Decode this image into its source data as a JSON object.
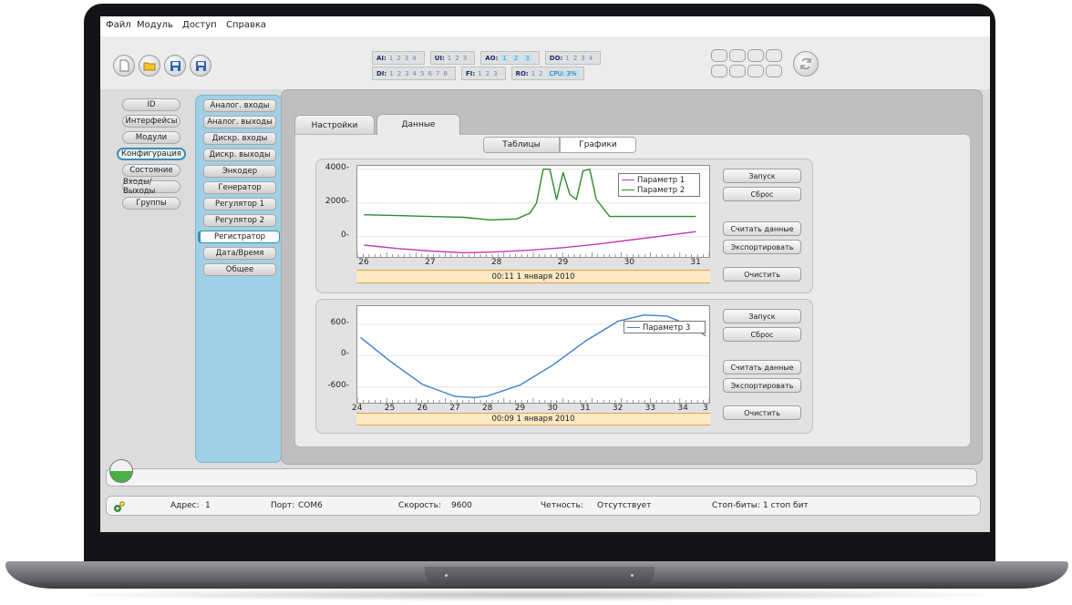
{
  "menu": [
    "Файл",
    "Модуль",
    "Доступ",
    "Справка"
  ],
  "toolbar": {
    "io_row1": [
      {
        "label": "AI:",
        "nums": [
          "1",
          "2",
          "3",
          "4"
        ]
      },
      {
        "label": "UI:",
        "nums": [
          "1",
          "2",
          "3"
        ]
      },
      {
        "label": "AO:",
        "nums": [
          "1",
          "2",
          "3"
        ],
        "highlight": true
      },
      {
        "label": "DO:",
        "nums": [
          "1",
          "2",
          "3",
          "4"
        ]
      }
    ],
    "io_row2": [
      {
        "label": "DI:",
        "nums": [
          "1",
          "2",
          "3",
          "4",
          "5",
          "6",
          "7",
          "8"
        ]
      },
      {
        "label": "FI:",
        "nums": [
          "1",
          "2",
          "3"
        ]
      },
      {
        "label": "RO:",
        "nums": [
          "1",
          "2"
        ]
      }
    ],
    "cpu": "CPU: 3%"
  },
  "nav_primary": [
    "ID",
    "Интерфейсы",
    "Модули",
    "Конфигурация",
    "Состояние",
    "Входы/Выходы",
    "Группы"
  ],
  "nav_primary_active": 3,
  "nav_secondary": [
    "Аналог. входы",
    "Аналог. выходы",
    "Дискр. входы",
    "Дискр. выходы",
    "Энкодер",
    "Генератор",
    "Регулятор 1",
    "Регулятор 2",
    "Регистратор",
    "Дата/Время",
    "Общее"
  ],
  "nav_secondary_active": 8,
  "tabs": [
    "Настройки",
    "Данные"
  ],
  "tabs_active": 1,
  "view_toggle": [
    "Таблицы",
    "Графики"
  ],
  "view_active": 1,
  "buttons": {
    "start": "Запуск",
    "reset": "Сброс",
    "read": "Считать данные",
    "export": "Экспортировать",
    "clear": "Очистить"
  },
  "chart1_caption": "00:11 1 января 2010",
  "chart2_caption": "00:09 1 января 2010",
  "status": {
    "address_label": "Адрес:",
    "address": "1",
    "port_label": "Порт:",
    "port": "COM6",
    "speed_label": "Скорость:",
    "speed": "9600",
    "parity_label": "Четность:",
    "parity": "Отсутствует",
    "stopbits_label": "Стоп-биты:",
    "stopbits": "1 стоп бит"
  },
  "colors": {
    "series1": "#c23bb0",
    "series2": "#2f8a2f",
    "series3": "#3b82c9",
    "accent": "#3e8fb3"
  },
  "chart_data": [
    {
      "type": "line",
      "ylim": [
        -1200,
        4200
      ],
      "xlim": [
        25.9,
        31.2
      ],
      "xticks": [
        "26",
        "27",
        "28",
        "29",
        "30",
        "31"
      ],
      "yticks": [
        "4000",
        "2000",
        "0"
      ],
      "series": [
        {
          "name": "Параметр 1",
          "x": [
            26.0,
            26.5,
            27.0,
            27.5,
            28.0,
            28.5,
            29.0,
            29.5,
            30.0,
            30.5,
            31.0
          ],
          "y": [
            -500,
            -700,
            -850,
            -950,
            -900,
            -800,
            -650,
            -450,
            -200,
            50,
            300
          ]
        },
        {
          "name": "Параметр 2",
          "x": [
            26.0,
            26.5,
            27.0,
            27.5,
            27.9,
            28.3,
            28.5,
            28.6,
            28.7,
            28.8,
            28.9,
            29.0,
            29.1,
            29.2,
            29.3,
            29.4,
            29.5,
            29.7,
            30.0,
            30.5,
            31.0
          ],
          "y": [
            1300,
            1250,
            1200,
            1150,
            1000,
            1050,
            1400,
            2000,
            4000,
            4000,
            2200,
            3800,
            2500,
            2200,
            3900,
            4000,
            2200,
            1200,
            1200,
            1200,
            1200
          ]
        }
      ]
    },
    {
      "type": "line",
      "ylim": [
        -900,
        950
      ],
      "xlim": [
        24.0,
        34.8
      ],
      "xticks": [
        "24",
        "25",
        "26",
        "27",
        "28",
        "29",
        "30",
        "31",
        "32",
        "33",
        "34",
        "3"
      ],
      "yticks": [
        "600",
        "0",
        "-600"
      ],
      "series": [
        {
          "name": "Параметр 3",
          "x": [
            24.1,
            25,
            26,
            27,
            27.6,
            28,
            29,
            30,
            31,
            32,
            32.8,
            33.5,
            34.2,
            34.7
          ],
          "y": [
            350,
            -100,
            -550,
            -780,
            -800,
            -770,
            -560,
            -180,
            280,
            660,
            780,
            760,
            580,
            380
          ]
        }
      ]
    }
  ]
}
